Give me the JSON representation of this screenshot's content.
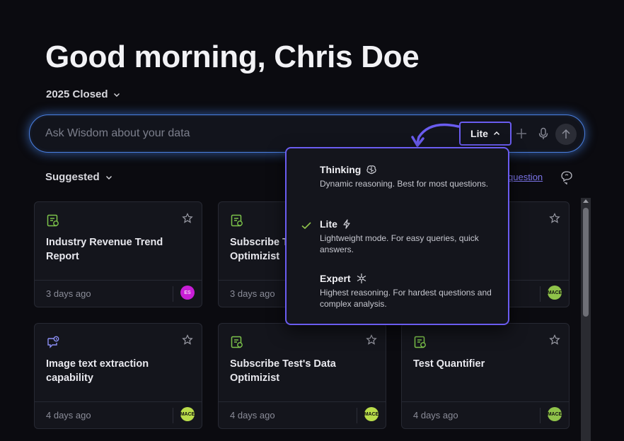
{
  "greeting": "Good morning, Chris Doe",
  "period_selector": "2025 Closed",
  "chat": {
    "placeholder": "Ask Wisdom about your data",
    "mode_label": "Lite"
  },
  "suggested_label": "Suggested",
  "ask_link": "question",
  "mode_menu": {
    "options": [
      {
        "label": "Thinking",
        "icon": "brain-icon",
        "description": "Dynamic reasoning. Best for most questions.",
        "selected": false
      },
      {
        "label": "Lite",
        "icon": "bolt-icon",
        "description": "Lightweight mode. For easy queries, quick answers.",
        "selected": true
      },
      {
        "label": "Expert",
        "icon": "snowflake-icon",
        "description": "Highest reasoning. For hardest questions and complex analysis.",
        "selected": false
      }
    ]
  },
  "cards": [
    {
      "title": "Industry Revenue Trend Report",
      "time": "3 days ago",
      "icon": "report-icon",
      "avatar": "ES",
      "avatar_color": "#c81ed6"
    },
    {
      "title": "Subscribe Test's Data Optimizist",
      "time": "3 days ago",
      "icon": "report-icon",
      "avatar": "",
      "avatar_color": ""
    },
    {
      "title": "",
      "time": "",
      "icon": "",
      "avatar": "MACE",
      "avatar_color": "#8fc34a"
    },
    {
      "title": "Image text extraction capability",
      "time": "4 days ago",
      "icon": "chat-search-icon",
      "avatar": "MACE",
      "avatar_color": "#b9dc4a"
    },
    {
      "title": "Subscribe Test's Data Optimizist",
      "time": "4 days ago",
      "icon": "report-icon",
      "avatar": "MACE",
      "avatar_color": "#b9dc4a"
    },
    {
      "title": "Test Quantifier",
      "time": "4 days ago",
      "icon": "report-icon",
      "avatar": "MACE",
      "avatar_color": "#8fc34a"
    }
  ],
  "colors": {
    "accent": "#6a5cf0",
    "glow": "#4a7fe0",
    "report_icon": "#7cc34a",
    "chat_icon": "#8b8ff5",
    "background": "#0b0b10"
  }
}
